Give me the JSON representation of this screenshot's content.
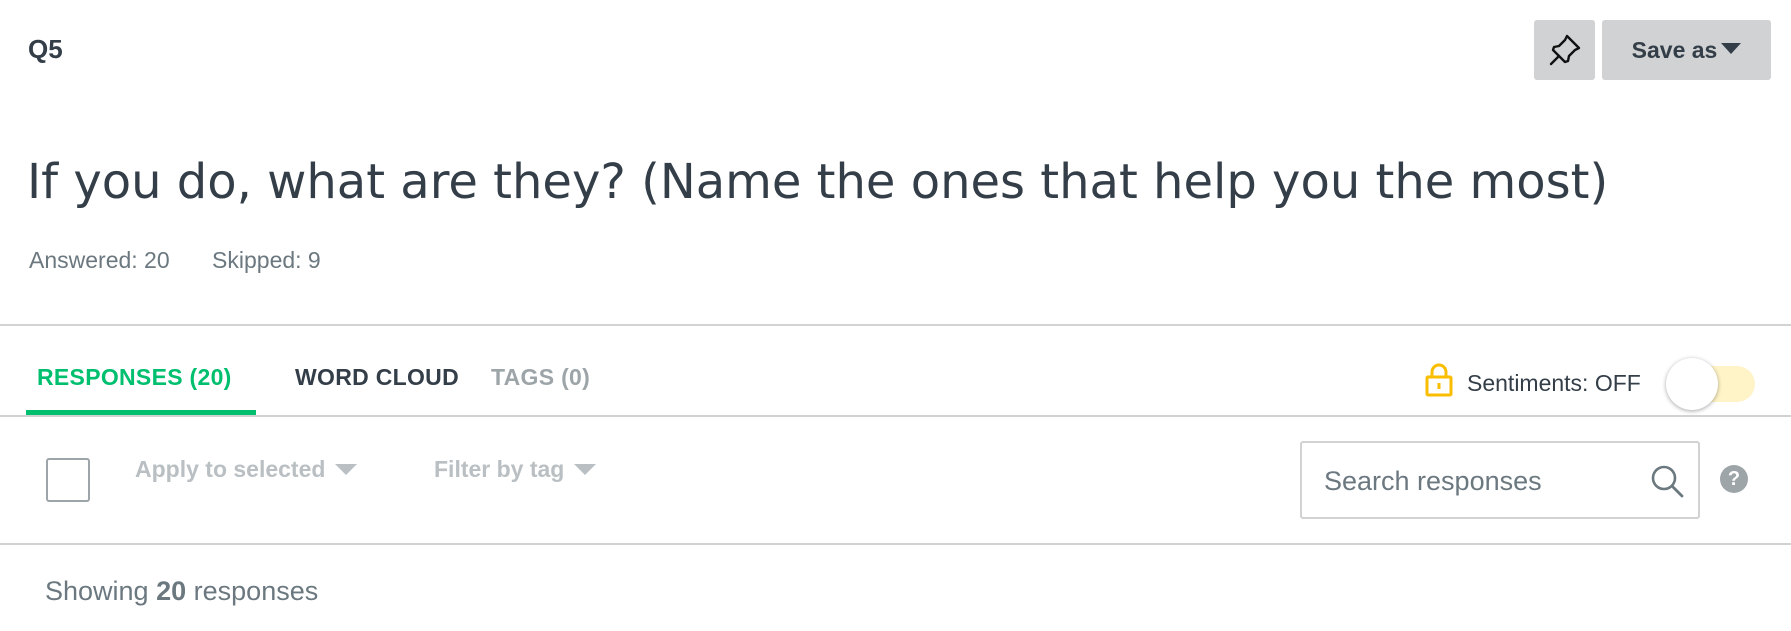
{
  "header": {
    "question_label": "Q5",
    "pin_icon": "pin-icon",
    "save_as_label": "Save as"
  },
  "question": {
    "text": "If you do, what are they? (Name the ones that help you the most)",
    "answered": "Answered: 20",
    "skipped": "Skipped: 9"
  },
  "tabs": [
    {
      "label": "RESPONSES (20)",
      "active": true
    },
    {
      "label": "WORD CLOUD",
      "active": false
    },
    {
      "label": "TAGS (0)",
      "active": false
    }
  ],
  "sentiments": {
    "lock_icon": "lock-icon",
    "label": "Sentiments: OFF",
    "enabled": false
  },
  "toolbar": {
    "apply_label": "Apply to selected",
    "filter_label": "Filter by tag",
    "search_placeholder": "Search responses",
    "help_glyph": "?"
  },
  "results": {
    "prefix": "Showing",
    "count": "20",
    "suffix": "responses"
  },
  "colors": {
    "accent_green": "#00bf6f",
    "lock_yellow": "#f9be00",
    "button_gray": "#d0d2d3",
    "text_dark": "#333e48"
  }
}
